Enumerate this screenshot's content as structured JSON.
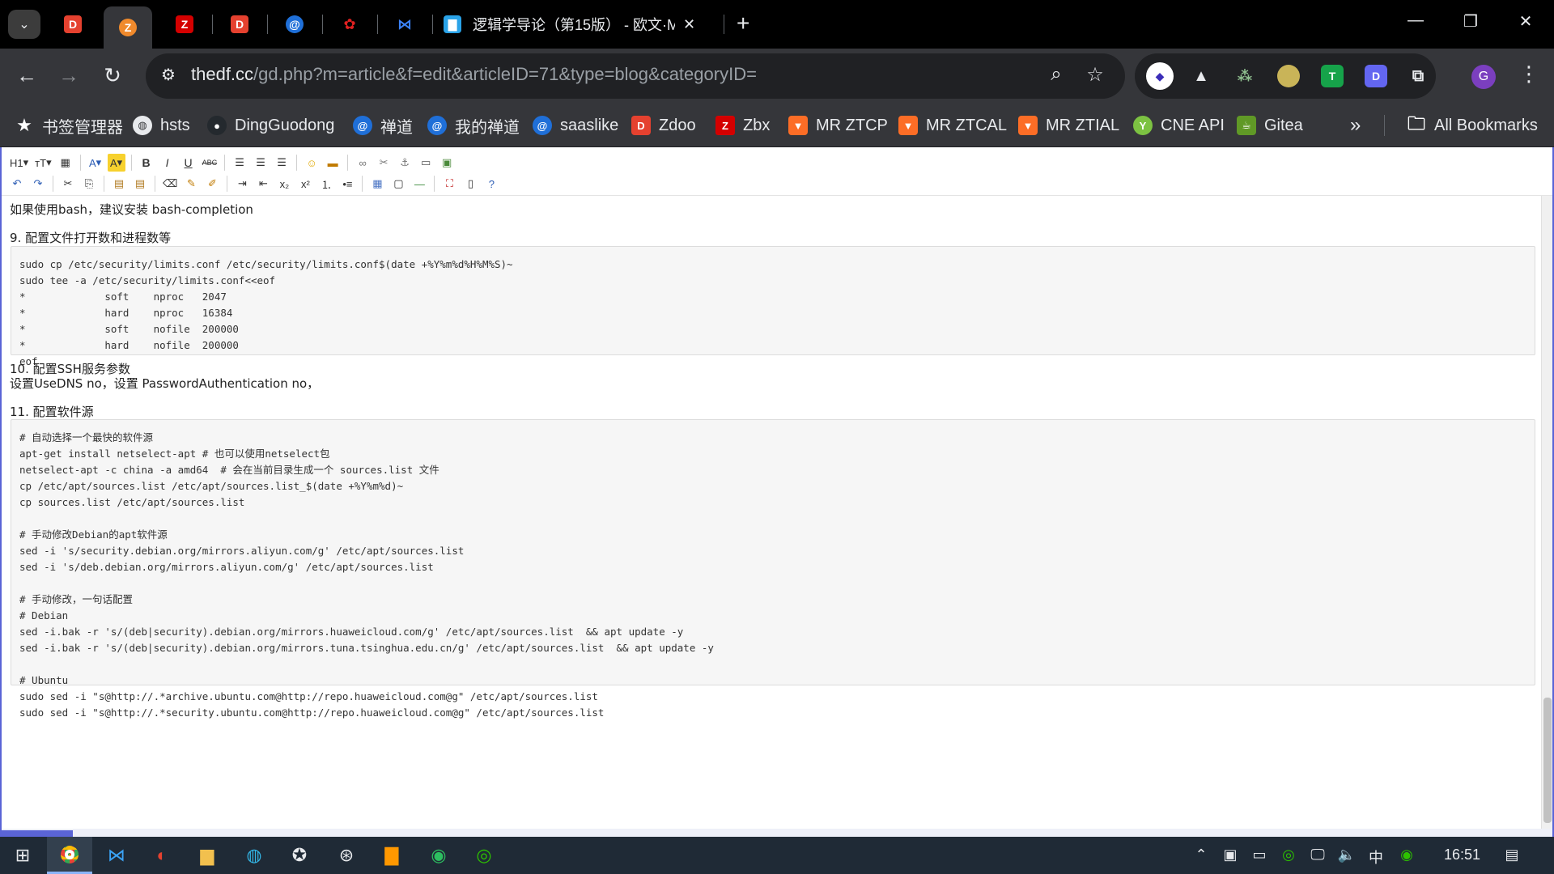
{
  "browser": {
    "active_tab_title": "逻辑学导论（第15版） - 欧文·M",
    "tab_close": "✕",
    "new_tab": "+",
    "url_host": "thedf.cc",
    "url_path": "/gd.php?m=article&f=edit&articleID=71&type=blog&categoryID=",
    "avatar_letter": "G"
  },
  "bookmarks": [
    {
      "label": "书签管理器",
      "icon": "star-icon",
      "color": "#35363a"
    },
    {
      "label": "hsts",
      "icon": "globe-icon",
      "color": "#35363a"
    },
    {
      "label": "DingGuodong",
      "icon": "github-icon",
      "color": "#24292e"
    },
    {
      "label": "禅道",
      "icon": "zentao-icon",
      "color": "#1f6fd8"
    },
    {
      "label": "我的禅道",
      "icon": "zentao-icon",
      "color": "#1f6fd8"
    },
    {
      "label": "saaslike",
      "icon": "zentao-icon",
      "color": "#1f6fd8"
    },
    {
      "label": "Zdoo",
      "icon": "zdoo-icon",
      "color": "#e5412f"
    },
    {
      "label": "Zbx",
      "icon": "zabbix-icon",
      "color": "#d40000"
    },
    {
      "label": "MR ZTCP",
      "icon": "gitlab-icon",
      "color": "#fc6d26"
    },
    {
      "label": "MR ZTCAL",
      "icon": "gitlab-icon",
      "color": "#fc6d26"
    },
    {
      "label": "MR ZTIAL",
      "icon": "gitlab-icon",
      "color": "#fc6d26"
    },
    {
      "label": "CNE API",
      "icon": "yapi-icon",
      "color": "#7cc242"
    },
    {
      "label": "Gitea",
      "icon": "gitea-icon",
      "color": "#609926"
    }
  ],
  "all_bookmarks": "All Bookmarks",
  "editor": {
    "row1_labels": [
      "H1",
      "тT",
      "A",
      "A",
      "B",
      "I",
      "U",
      "ABC"
    ],
    "font_btn": "A"
  },
  "content": {
    "p1": "如果使用bash，建议安装 bash-completion",
    "h9": "9. 配置文件打开数和进程数等",
    "code1": [
      "sudo cp /etc/security/limits.conf /etc/security/limits.conf$(date +%Y%m%d%H%M%S)~",
      "sudo tee -a /etc/security/limits.conf<<eof",
      "*             soft    nproc   2047",
      "*             hard    nproc   16384",
      "*             soft    nofile  200000",
      "*             hard    nofile  200000",
      "eof"
    ],
    "h10": "10. 配置SSH服务参数",
    "p10": "设置UseDNS no，设置 PasswordAuthentication no，",
    "h11": "11. 配置软件源",
    "code2": [
      "# 自动选择一个最快的软件源",
      "apt-get install netselect-apt # 也可以使用netselect包",
      "netselect-apt -c china -a amd64  # 会在当前目录生成一个 sources.list 文件",
      "cp /etc/apt/sources.list /etc/apt/sources.list_$(date +%Y%m%d)~",
      "cp sources.list /etc/apt/sources.list",
      "",
      "# 手动修改Debian的apt软件源",
      "sed -i 's/security.debian.org/mirrors.aliyun.com/g' /etc/apt/sources.list",
      "sed -i 's/deb.debian.org/mirrors.aliyun.com/g' /etc/apt/sources.list",
      "",
      "# 手动修改，一句话配置",
      "# Debian",
      "sed -i.bak -r 's/(deb|security).debian.org/mirrors.huaweicloud.com/g' /etc/apt/sources.list  && apt update -y",
      "sed -i.bak -r 's/(deb|security).debian.org/mirrors.tuna.tsinghua.edu.cn/g' /etc/apt/sources.list  && apt update -y",
      "",
      "# Ubuntu",
      "sudo sed -i \"s@http://.*archive.ubuntu.com@http://repo.huaweicloud.com@g\" /etc/apt/sources.list",
      "sudo sed -i \"s@http://.*security.ubuntu.com@http://repo.huaweicloud.com@g\" /etc/apt/sources.list",
      ""
    ]
  },
  "taskbar": {
    "ime": "中",
    "time": "16:51"
  }
}
